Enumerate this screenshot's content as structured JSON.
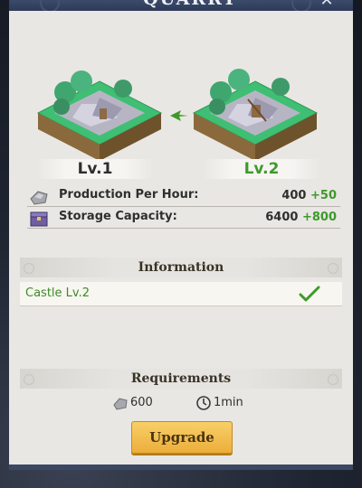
{
  "dialog": {
    "title": "QUARRY",
    "close_symbol": "✕"
  },
  "levels": {
    "current": "Lv.1",
    "next": "Lv.2"
  },
  "stats": [
    {
      "label": "Production Per Hour:",
      "value": "400",
      "increase": "+50",
      "icon": "stone-icon"
    },
    {
      "label": "Storage Capacity:",
      "value": "6400",
      "increase": "+800",
      "icon": "storage-chest-icon"
    }
  ],
  "information": {
    "header": "Information",
    "requirement": {
      "label": "Castle Lv.2",
      "met": true
    }
  },
  "requirements": {
    "header": "Requirements",
    "stone_cost": "600",
    "time_cost": "1min"
  },
  "upgrade_button": {
    "label": "Upgrade"
  },
  "colors": {
    "increase_green": "#3d9a2a",
    "button_gold": "#f0b94a",
    "panel_bg": "#e9e7e3",
    "header_blue": "#3c4b6c"
  }
}
